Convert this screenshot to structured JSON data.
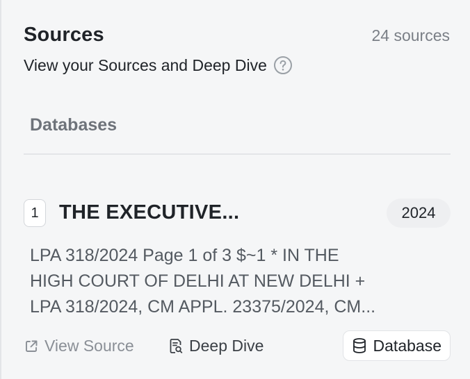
{
  "header": {
    "title": "Sources",
    "count": "24 sources",
    "subtitle": "View your Sources and Deep Dive"
  },
  "section": {
    "label": "Databases"
  },
  "source": {
    "index": "1",
    "title": "THE EXECUTIVE...",
    "year": "2024",
    "snippet_lines": [
      "LPA 318/2024 Page 1 of 3 $~1 * IN THE",
      "HIGH COURT OF DELHI AT NEW DELHI +",
      "LPA 318/2024, CM APPL. 23375/2024, CM..."
    ],
    "actions": {
      "view_source": "View Source",
      "deep_dive": "Deep Dive"
    },
    "type_label": "Database"
  },
  "icons": {
    "help": "question-circle-icon",
    "view_source": "external-link-icon",
    "deep_dive": "document-search-icon",
    "database": "database-icon"
  }
}
